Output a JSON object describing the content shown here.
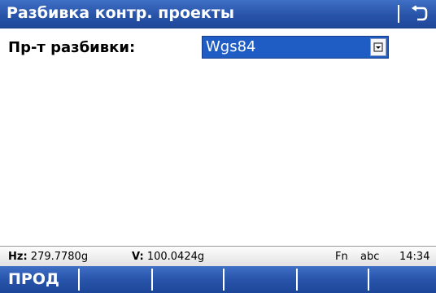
{
  "titlebar": {
    "title": "Разбивка контр. проекты",
    "back_icon": "back-arrow-icon"
  },
  "form": {
    "label": "Пр-т разбивки:",
    "value": "Wgs84",
    "dropdown_icon": "dropdown-icon"
  },
  "status": {
    "hz_label": "Hz:",
    "hz_value": "279.7780g",
    "v_label": "V:",
    "v_value": "100.0424g",
    "fn": "Fn",
    "input_mode": "abc",
    "time": "14:34"
  },
  "softkeys": [
    "ПРОД",
    "",
    "",
    "",
    "",
    ""
  ],
  "colors": {
    "accent": "#2854a8",
    "selection": "#1f5cc4"
  }
}
